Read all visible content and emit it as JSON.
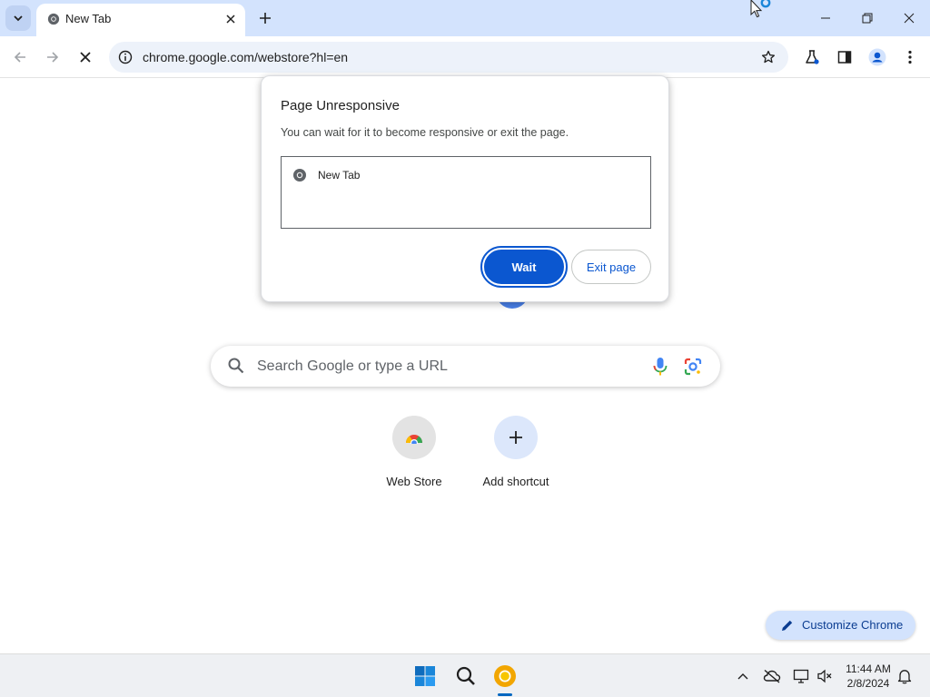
{
  "browser": {
    "tab": {
      "title": "New Tab"
    },
    "address_bar": {
      "url": "chrome.google.com/webstore?hl=en"
    }
  },
  "new_tab_page": {
    "search_placeholder": "Search Google or type a URL",
    "shortcuts": [
      {
        "label": "Web Store"
      },
      {
        "label": "Add shortcut"
      }
    ],
    "customize_label": "Customize Chrome"
  },
  "dialog": {
    "title": "Page Unresponsive",
    "message": "You can wait for it to become responsive or exit the page.",
    "pages": [
      {
        "label": "New Tab"
      }
    ],
    "wait_label": "Wait",
    "exit_label": "Exit page"
  },
  "taskbar": {
    "time": "11:44 AM",
    "date": "2/8/2024"
  },
  "colors": {
    "tab_strip": "#d3e3fd",
    "primary_button": "#0b57d0",
    "omnibox": "#edf2fa"
  },
  "icons": [
    "tab-search-icon",
    "chrome-icon",
    "close-icon",
    "plus-icon",
    "minimize-icon",
    "restore-icon",
    "back-icon",
    "forward-icon",
    "stop-icon",
    "info-icon",
    "star-icon",
    "labs-icon",
    "side-panel-icon",
    "profile-icon",
    "menu-icon",
    "search-icon",
    "mic-icon",
    "lens-icon",
    "pencil-icon",
    "windows-start-icon",
    "taskbar-search-icon",
    "chrome-canary-icon",
    "chevron-up-icon",
    "cloud-off-icon",
    "network-icon",
    "volume-muted-icon",
    "notification-bell-icon"
  ]
}
